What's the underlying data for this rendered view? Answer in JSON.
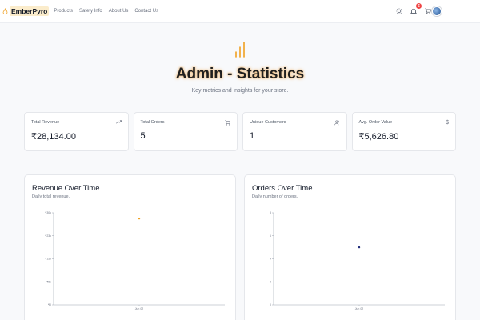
{
  "nav": {
    "brand": "EmberPyro",
    "links": [
      "Products",
      "Safety Info",
      "About Us",
      "Contact Us"
    ],
    "notification_count": "6"
  },
  "header": {
    "title": "Admin - Statistics",
    "subtitle": "Key metrics and insights for your store."
  },
  "stats": [
    {
      "label": "Total Revenue",
      "value": "₹28,134.00",
      "icon": "trending-up-icon"
    },
    {
      "label": "Total Orders",
      "value": "5",
      "icon": "cart-icon"
    },
    {
      "label": "Unique Customers",
      "value": "1",
      "icon": "users-icon"
    },
    {
      "label": "Avg. Order Value",
      "value": "₹5,626.80",
      "icon": "dollar-icon"
    }
  ],
  "colors": {
    "accent": "#f0a020",
    "navy": "#1e2a78"
  },
  "chart_data": [
    {
      "type": "scatter",
      "title": "Revenue Over Time",
      "subtitle": "Daily total revenue.",
      "categories": [
        "Jun 02"
      ],
      "values": [
        28134
      ],
      "y_ticks": [
        "₹0",
        "₹8k",
        "₹15k",
        "₹23k",
        "₹30k"
      ],
      "ylim": [
        0,
        30000
      ],
      "color": "#f0a020"
    },
    {
      "type": "scatter",
      "title": "Orders Over Time",
      "subtitle": "Daily number of orders.",
      "categories": [
        "Jun 02"
      ],
      "values": [
        5
      ],
      "y_ticks": [
        "0",
        "2",
        "4",
        "6",
        "8"
      ],
      "ylim": [
        0,
        8
      ],
      "color": "#1e2a78"
    }
  ]
}
